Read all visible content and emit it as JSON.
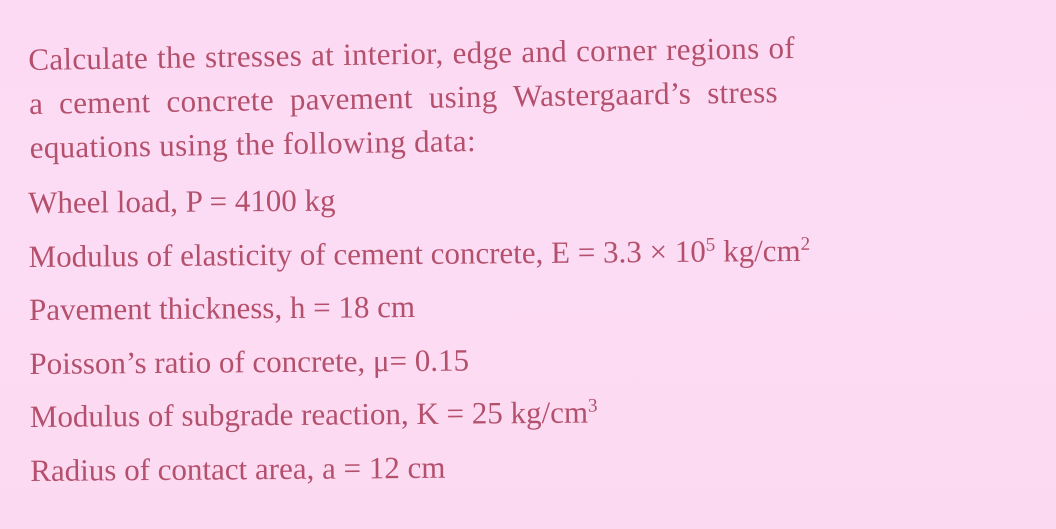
{
  "document": {
    "background_color": "#fcdcf4",
    "text_color": "#b4506c",
    "problem_statement": {
      "lines": [
        "Calculate the stresses at interior, edge and corner regions of",
        "a cement concrete pavement using Wastergaard’s stress",
        "equations using the following data:"
      ]
    },
    "given_data": [
      {
        "label": "Wheel load, P = ",
        "value": "4100",
        "unit": " kg",
        "unit_sup": ""
      },
      {
        "label": "Modulus of elasticity of cement concrete, E = ",
        "value": "3.3 × 10",
        "value_sup": "5",
        "unit": " kg/cm",
        "unit_sup": "2"
      },
      {
        "label": "Pavement thickness, h = ",
        "value": "18",
        "unit": " cm",
        "unit_sup": ""
      },
      {
        "label": "Poisson’s ratio of concrete, μ= ",
        "value": "0.15",
        "unit": "",
        "unit_sup": ""
      },
      {
        "label": "Modulus of subgrade reaction, K = ",
        "value": "25",
        "unit": " kg/cm",
        "unit_sup": "3"
      },
      {
        "label": "Radius of contact area, a = ",
        "value": "12",
        "unit": " cm",
        "unit_sup": ""
      }
    ]
  }
}
